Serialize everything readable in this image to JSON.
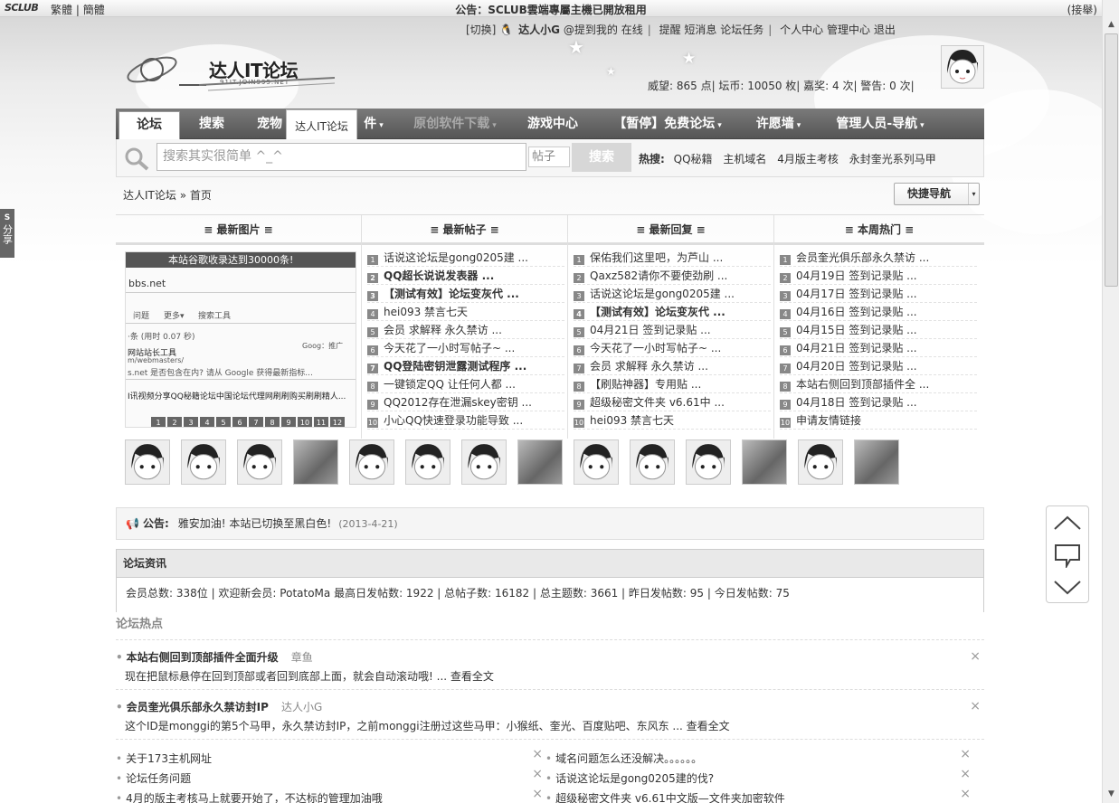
{
  "topbar": {
    "logo": "SCLUB",
    "lang_trad": "繁體",
    "lang_simp": "簡體",
    "notice": "公告：SCLUB雲端專屬主機已開放租用",
    "collapse": "(接舉)"
  },
  "usernav": {
    "switch": "[切换]",
    "name": "达人小G",
    "mention": "@提到我的",
    "online": "在线",
    "remind": "提醒",
    "pm": "短消息",
    "task": "论坛任务",
    "usercenter": "个人中心",
    "admin": "管理中心",
    "logout": "退出"
  },
  "logo": {
    "name": "达人IT论坛",
    "sub": "91IT.JOIN995.NET"
  },
  "credits": "威望: 865 点| 坛币: 10050 枚| 嘉奖: 4 次| 警告: 0 次|",
  "nav": {
    "items": [
      "论坛",
      "搜索",
      "宠物",
      "件",
      "原创软件下载",
      "游戏中心",
      "【暂停】免费论坛",
      "许愿墙",
      "管理人员-导航"
    ],
    "tooltip": "达人IT论坛"
  },
  "search": {
    "placeholder": "搜索其实很简单 ^_^",
    "type": "帖子",
    "button": "搜索",
    "hot_label": "热搜:",
    "hot": [
      "QQ秘籍",
      "主机域名",
      "4月版主考核",
      "永封奎光系列马甲"
    ]
  },
  "breadcrumb": {
    "site": "达人IT论坛",
    "sep": "»",
    "home": "首页"
  },
  "quicknav": "快捷导航",
  "grid": {
    "headers": [
      "≡ 最新图片 ≡",
      "≡ 最新帖子 ≡",
      "≡ 最新回复 ≡",
      "≡ 本周热门 ≡"
    ],
    "image_banner": "本站谷歌收录达到30000条!",
    "image_texts": [
      "bbs.net",
      "问题",
      "更多▾",
      "搜索工具",
      "·条 (用时 0.07 秒)",
      "Goog：推广",
      "网站站长工具",
      "m/webmasters/",
      "s.net 是否包含在内? 请从 Google 获得最新指标...",
      "I讯视频分享QQ秘籍论坛中国论坛代理网刷刷购买刷刷精人..."
    ],
    "pager": [
      "1",
      "2",
      "3",
      "4",
      "5",
      "6",
      "7",
      "8",
      "9",
      "10",
      "11",
      "12"
    ],
    "new_posts": [
      {
        "n": "1",
        "t": "话说这论坛是gong0205建 ...",
        "b": false
      },
      {
        "n": "2",
        "t": "QQ超长说说发表器 ...",
        "b": true
      },
      {
        "n": "3",
        "t": "【测试有效】论坛变灰代 ...",
        "b": true
      },
      {
        "n": "4",
        "t": "hei093 禁言七天",
        "b": false
      },
      {
        "n": "5",
        "t": "会员 求解释 永久禁访 ...",
        "b": false
      },
      {
        "n": "6",
        "t": "今天花了一小时写帖子~ ...",
        "b": false
      },
      {
        "n": "7",
        "t": "QQ登陆密钥泄露测试程序 ...",
        "b": true
      },
      {
        "n": "8",
        "t": "一键锁定QQ 让任何人都 ...",
        "b": false
      },
      {
        "n": "9",
        "t": "QQ2012存在泄漏skey密钥 ...",
        "b": false
      },
      {
        "n": "10",
        "t": "小心QQ快速登录功能导致 ...",
        "b": false
      }
    ],
    "new_replies": [
      {
        "n": "1",
        "t": "保佑我们这里吧，为芦山 ...",
        "b": false
      },
      {
        "n": "2",
        "t": "Qaxz582请你不要使劲刷 ...",
        "b": false
      },
      {
        "n": "3",
        "t": "话说这论坛是gong0205建 ...",
        "b": false
      },
      {
        "n": "4",
        "t": "【测试有效】论坛变灰代 ...",
        "b": true
      },
      {
        "n": "5",
        "t": "04月21日 签到记录贴 ...",
        "b": false
      },
      {
        "n": "6",
        "t": "今天花了一小时写帖子~ ...",
        "b": false
      },
      {
        "n": "7",
        "t": "会员 求解释 永久禁访 ...",
        "b": false
      },
      {
        "n": "8",
        "t": "【刷贴神器】专用贴 ...",
        "b": false
      },
      {
        "n": "9",
        "t": "超级秘密文件夹 v6.61中 ...",
        "b": false
      },
      {
        "n": "10",
        "t": "hei093 禁言七天",
        "b": false
      }
    ],
    "weekly_hot": [
      {
        "n": "1",
        "t": "会员奎光俱乐部永久禁访 ...",
        "b": false
      },
      {
        "n": "2",
        "t": "04月19日 签到记录贴 ...",
        "b": false
      },
      {
        "n": "3",
        "t": "04月17日 签到记录贴 ...",
        "b": false
      },
      {
        "n": "4",
        "t": "04月16日 签到记录贴 ...",
        "b": false
      },
      {
        "n": "5",
        "t": "04月15日 签到记录贴 ...",
        "b": false
      },
      {
        "n": "6",
        "t": "04月21日 签到记录贴 ...",
        "b": false
      },
      {
        "n": "7",
        "t": "04月20日 签到记录贴 ...",
        "b": false
      },
      {
        "n": "8",
        "t": "本站右侧回到顶部插件全 ...",
        "b": false
      },
      {
        "n": "9",
        "t": "04月18日 签到记录贴 ...",
        "b": false
      },
      {
        "n": "10",
        "t": "申请友情链接",
        "b": false
      }
    ]
  },
  "avatars": [
    "cartoon",
    "cartoon",
    "cartoon",
    "photo",
    "cartoon",
    "cartoon",
    "cartoon",
    "photo",
    "cartoon",
    "cartoon",
    "cartoon",
    "photo",
    "cartoon",
    "photo"
  ],
  "announcement": {
    "label": "公告:",
    "text": "雅安加油! 本站已切换至黑白色!",
    "date": "(2013-4-21)"
  },
  "forum_info": {
    "title": "论坛资讯",
    "stats": "会员总数: 338位 | 欢迎新会员: PotatoMa 最高日发帖数: 1922 | 总帖子数: 16182 | 总主题数: 3661 | 昨日发帖数: 95 | 今日发帖数: 75"
  },
  "hot": {
    "title": "论坛热点",
    "featured": [
      {
        "title": "本站右侧回到顶部插件全面升级",
        "author": "章鱼",
        "summary": "现在把鼠标悬停在回到顶部或者回到底部上面，就会自动滚动哦!   ... 查看全文"
      },
      {
        "title": "会员奎光俱乐部永久禁访封IP",
        "author": "达人小G",
        "summary": "这个ID是monggi的第5个马甲，永久禁访封IP，之前monggi注册过这些马甲：小猴纸、奎光、百度贴吧、东风东 ... 查看全文"
      }
    ],
    "left": [
      "关于173主机网址",
      "论坛任务问题",
      "4月的版主考核马上就要开始了，不达标的管理加油哦"
    ],
    "right": [
      "域名问题怎么还没解决。。。。。。",
      "话说这论坛是gong0205建的伐?",
      "超级秘密文件夹 v6.61中文版—文件夹加密软件"
    ]
  },
  "share": "分享"
}
